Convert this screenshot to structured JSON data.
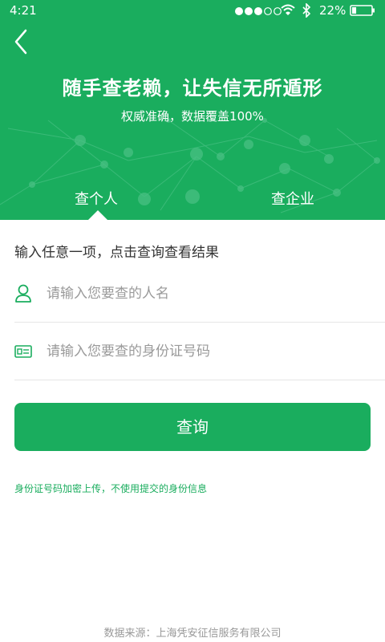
{
  "status_bar": {
    "time": "4:21",
    "battery_percent": "22%",
    "battery_level": 0.22,
    "signal_bars_filled": 3,
    "signal_bars_total": 5
  },
  "header": {
    "title": "随手查老赖，让失信无所遁形",
    "subtitle": "权威准确，数据覆盖100%",
    "background_color": "#1aad5e"
  },
  "tabs": [
    {
      "label": "查个人",
      "active": true
    },
    {
      "label": "查企业",
      "active": false
    }
  ],
  "form": {
    "instruction": "输入任意一项，点击查询查看结果",
    "name_placeholder": "请输入您要查的人名",
    "name_icon": "person-icon",
    "id_placeholder": "请输入您要查的身份证号码",
    "id_icon": "id-card-icon",
    "submit_label": "查询"
  },
  "notice": "身份证号码加密上传，不使用提交的身份信息",
  "footer": "数据来源：上海凭安征信服务有限公司",
  "colors": {
    "accent": "#1aad5e",
    "text": "#333333",
    "placeholder": "#9a9a9a",
    "footer_text": "#999999"
  }
}
